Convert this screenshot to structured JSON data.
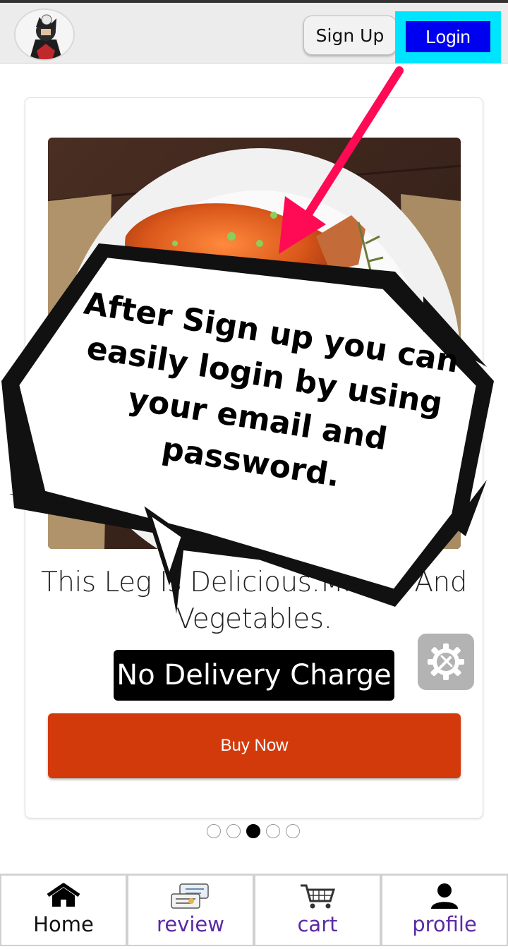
{
  "header": {
    "signup_label": "Sign Up",
    "login_label": "Login"
  },
  "card": {
    "title": "This Leg Is Delicious.Mix    ps And Vegetables.",
    "delivery_badge": "No Delivery Charge",
    "buy_label": "Buy Now"
  },
  "carousel": {
    "active_index": 2,
    "count": 5
  },
  "tutorial": {
    "message": "After Sign up you can easily login by using your email and password."
  },
  "nav": {
    "home": "Home",
    "review": "review",
    "cart": "cart",
    "profile": "profile"
  },
  "colors": {
    "login_highlight": "#00e5ff",
    "login_button": "#0000f0",
    "buy_button": "#d33a0b",
    "arrow": "#ff0055",
    "nav_purple": "#5b2aa3"
  }
}
